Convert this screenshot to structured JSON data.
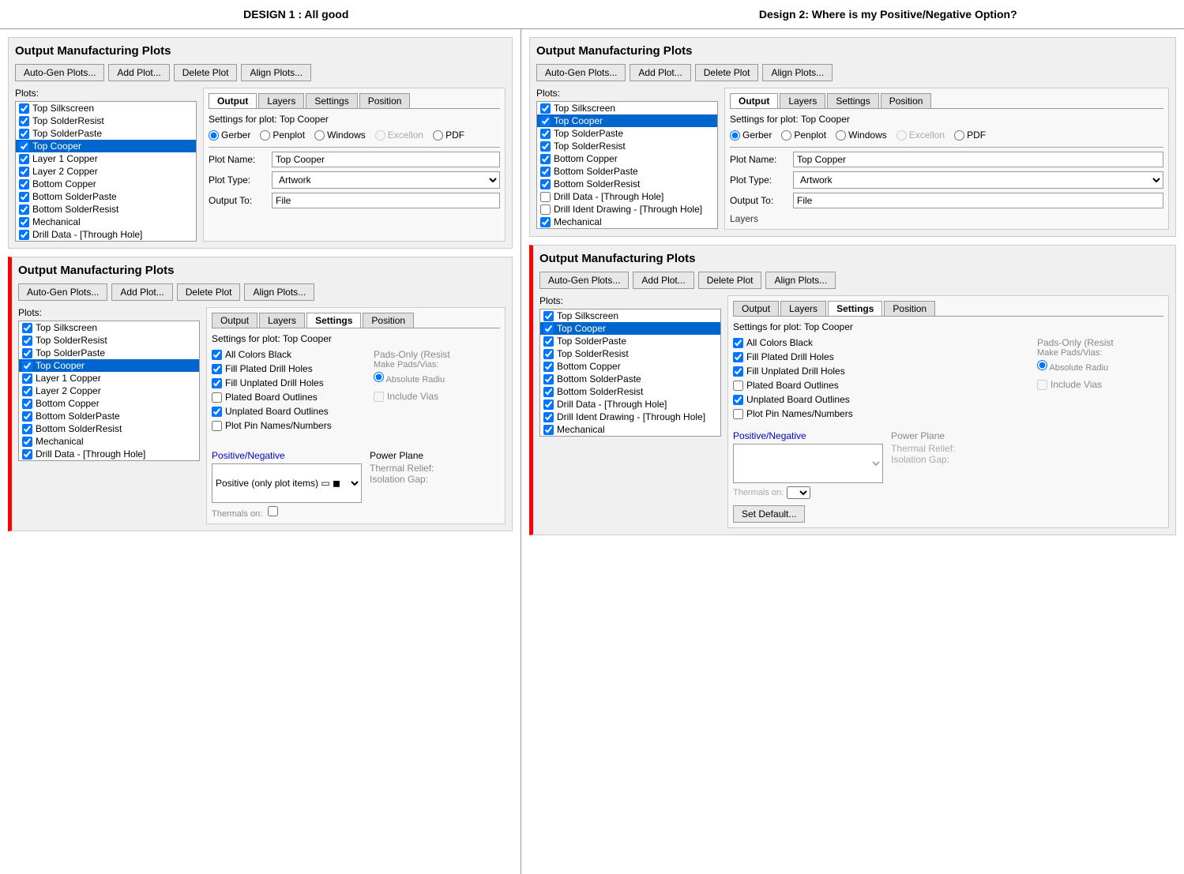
{
  "titles": {
    "left": "DESIGN 1 : All good",
    "right": "Design 2: Where is my Positive/Negative Option?"
  },
  "panel1": {
    "title": "Output Manufacturing Plots",
    "buttons": [
      "Auto-Gen Plots...",
      "Add Plot...",
      "Delete Plot",
      "Align Plots..."
    ],
    "plots_label": "Plots:",
    "plots_items": [
      "Top Silkscreen",
      "Top SolderResist",
      "Top SolderPaste",
      "Top Cooper",
      "Layer 1 Copper",
      "Layer 2 Copper",
      "Bottom Copper",
      "Bottom SolderPaste",
      "Bottom SolderResist",
      "Mechanical",
      "Drill Data - [Through Hole]"
    ],
    "selected_item": "Top Cooper",
    "tabs": [
      "Output",
      "Layers",
      "Settings",
      "Position"
    ],
    "active_tab": "Output",
    "settings_title": "Settings for plot: Top Cooper",
    "radio_options": [
      "Gerber",
      "Penplot",
      "Windows",
      "Excellon",
      "PDF"
    ],
    "selected_radio": "Gerber",
    "plot_name_label": "Plot Name:",
    "plot_name_value": "Top Cooper",
    "plot_type_label": "Plot Type:",
    "plot_type_value": "Artwork",
    "output_to_label": "Output To:",
    "output_to_value": "File"
  },
  "panel2": {
    "title": "Output Manufacturing Plots",
    "buttons": [
      "Auto-Gen Plots...",
      "Add Plot...",
      "Delete Plot",
      "Align Plots..."
    ],
    "plots_label": "Plots:",
    "plots_items": [
      "Top Silkscreen",
      "Top SolderResist",
      "Top SolderPaste",
      "Top Cooper",
      "Layer 1 Copper",
      "Layer 2 Copper",
      "Bottom Copper",
      "Bottom SolderPaste",
      "Bottom SolderResist",
      "Mechanical",
      "Drill Data - [Through Hole]"
    ],
    "selected_item": "Top Cooper",
    "tabs": [
      "Output",
      "Layers",
      "Settings",
      "Position"
    ],
    "active_tab": "Settings",
    "settings_title": "Settings for plot: Top Cooper",
    "checkboxes": [
      {
        "label": "All Colors Black",
        "checked": true
      },
      {
        "label": "Fill Plated Drill Holes",
        "checked": true
      },
      {
        "label": "Fill Unplated Drill Holes",
        "checked": true
      },
      {
        "label": "Plated Board Outlines",
        "checked": false
      },
      {
        "label": "Unplated Board Outlines",
        "checked": true
      },
      {
        "label": "Plot Pin Names/Numbers",
        "checked": false
      }
    ],
    "pads_only_label": "Pads-Only (Resist",
    "make_pads_label": "Make Pads/Vias:",
    "abs_radius_label": "Absolute Radiu",
    "include_vias_label": "Include Vias",
    "pos_neg_label": "Positive/Negative",
    "pos_neg_value": "Positive (only plot items)",
    "power_plane_label": "Power Plane",
    "thermal_relief_label": "Thermal Relief:",
    "isolation_gap_label": "Isolation Gap:",
    "thermals_on_label": "Thermals on:"
  },
  "panel3": {
    "title": "Output Manufacturing Plots",
    "buttons": [
      "Auto-Gen Plots...",
      "Add Plot...",
      "Delete Plot",
      "Align Plots..."
    ],
    "plots_label": "Plots:",
    "plots_items": [
      "Top Silkscreen",
      "Top Cooper",
      "Top SolderPaste",
      "Top SolderResist",
      "Bottom Copper",
      "Bottom SolderPaste",
      "Bottom SolderResist",
      "Drill Data - [Through Hole]",
      "Drill Ident Drawing - [Through Hole]",
      "Mechanical"
    ],
    "selected_item": "Top Cooper",
    "tabs": [
      "Output",
      "Layers",
      "Settings",
      "Position"
    ],
    "active_tab": "Output",
    "settings_title": "Settings for plot: Top Cooper",
    "radio_options": [
      "Gerber",
      "Penplot",
      "Windows",
      "Excellon",
      "PDF"
    ],
    "selected_radio": "Gerber",
    "plot_name_label": "Plot Name:",
    "plot_name_value": "Top Copper",
    "plot_type_label": "Plot Type:",
    "plot_type_value": "Artwork",
    "output_to_label": "Output To:",
    "output_to_value": "File",
    "layers_label": "Layers"
  },
  "panel4": {
    "title": "Output Manufacturing Plots",
    "buttons": [
      "Auto-Gen Plots...",
      "Add Plot...",
      "Delete Plot",
      "Align Plots..."
    ],
    "plots_label": "Plots:",
    "plots_items": [
      "Top Silkscreen",
      "Top Cooper",
      "Top SolderPaste",
      "Top SolderResist",
      "Bottom Copper",
      "Bottom SolderPaste",
      "Bottom SolderResist",
      "Drill Data - [Through Hole]",
      "Drill Ident Drawing - [Through Hole]",
      "Mechanical"
    ],
    "selected_item": "Top Cooper",
    "tabs": [
      "Output",
      "Layers",
      "Settings",
      "Position"
    ],
    "active_tab": "Settings",
    "settings_title": "Settings for plot: Top Cooper",
    "checkboxes": [
      {
        "label": "All Colors Black",
        "checked": true
      },
      {
        "label": "Fill Plated Drill Holes",
        "checked": true
      },
      {
        "label": "Fill Unplated Drill Holes",
        "checked": true
      },
      {
        "label": "Plated Board Outlines",
        "checked": false
      },
      {
        "label": "Unplated Board Outlines",
        "checked": true
      },
      {
        "label": "Plot Pin Names/Numbers",
        "checked": false
      }
    ],
    "pads_only_label": "Pads-Only (Resist",
    "make_pads_label": "Make Pads/Vias:",
    "abs_radius_label": "Absolute Radiu",
    "include_vias_label": "Include Vias",
    "pos_neg_label": "Positive/Negative",
    "power_plane_label": "Power Plane",
    "thermal_relief_label": "Thermal Relief:",
    "isolation_gap_label": "Isolation Gap:",
    "thermals_on_label": "Thermals on:",
    "set_default_label": "Set Default..."
  }
}
